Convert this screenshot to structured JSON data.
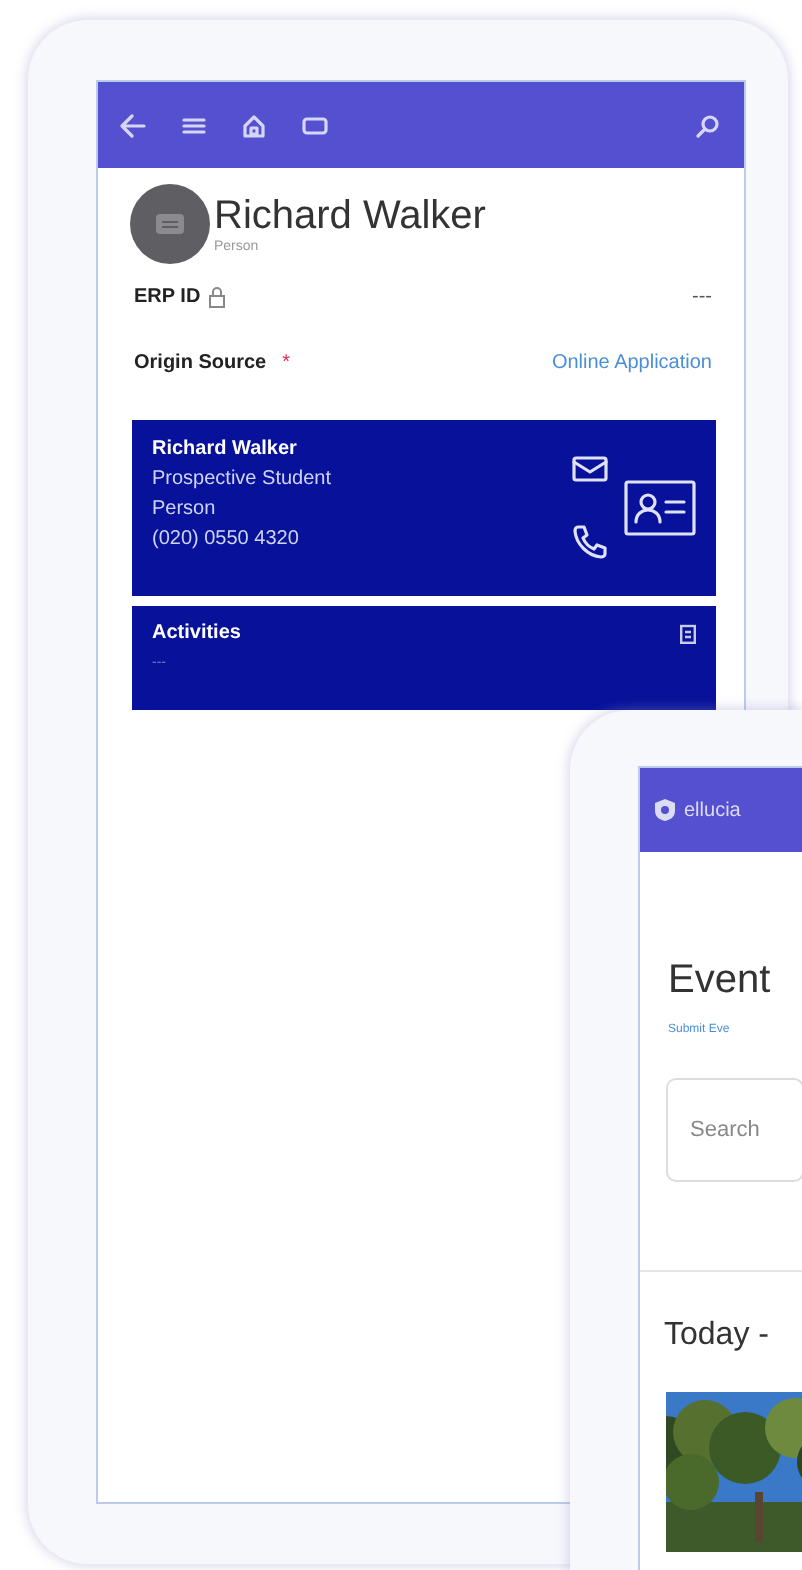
{
  "crm": {
    "record": {
      "name": "Richard Walker",
      "type": "Person"
    },
    "fields": [
      {
        "label": "ERP ID",
        "locked": true,
        "value": "---",
        "kind": "plain"
      },
      {
        "label": "Origin Source",
        "required_mark": "*",
        "locked": false,
        "value": "Online Application",
        "kind": "link"
      }
    ],
    "contact_card": {
      "lines": [
        "Richard Walker",
        "Prospective Student",
        "Person",
        "(020) 0550 4320"
      ]
    },
    "activities": {
      "title": "Activities",
      "value": "---"
    }
  },
  "events": {
    "brand": "ellucia",
    "title": "Event",
    "link": "Submit Eve",
    "search": {
      "placeholder": "Search"
    },
    "section": "Today -"
  }
}
